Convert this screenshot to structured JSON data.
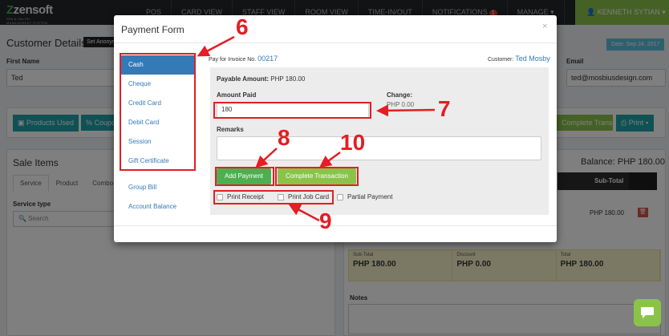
{
  "app": {
    "logo_text": "zensoft",
    "logo_subtext": "SPA & SALON MANAGEMENT SYSTEM",
    "nav": [
      {
        "label": "POS"
      },
      {
        "label": "CARD VIEW"
      },
      {
        "label": "STAFF VIEW"
      },
      {
        "label": "ROOM VIEW"
      },
      {
        "label": "TIME-IN/OUT"
      },
      {
        "label": "NOTIFICATIONS",
        "badge": "1"
      },
      {
        "label": "MANAGE ▾"
      }
    ],
    "user": "KENNETH SYTIAN ▾"
  },
  "background": {
    "customer_title": "Customer Details",
    "anon_button": "Set Anonymous",
    "date": "Date: Sep 24, 2017",
    "first_name_label": "First Name",
    "first_name_value": "Ted",
    "email_label": "Email",
    "email_value": "ted@mosbiusdesign.com",
    "products_button": "Products Used",
    "coupon_button": "Coupons",
    "complete_transaction_button": "Complete Transaction",
    "print_button": "Print ▾",
    "sale_items_title": "Sale Items",
    "tabs": [
      "Service",
      "Product",
      "Combo"
    ],
    "service_type_label": "Service type",
    "search_placeholder": "Search",
    "balance": "Balance: PHP 180.00",
    "table_header_subtotal": "Sub-Total",
    "table_row_subtotal": "PHP 180.00",
    "totals": [
      {
        "label": "Sub-Total",
        "value": "PHP 180.00"
      },
      {
        "label": "Discount",
        "value": "PHP 0.00"
      },
      {
        "label": "Total",
        "value": "PHP 180.00"
      }
    ],
    "notes_label": "Notes"
  },
  "modal": {
    "title": "Payment Form",
    "close": "×",
    "payment_methods": [
      "Cash",
      "Cheque",
      "Credit Card",
      "Debit Card",
      "Session",
      "Gift Certificate"
    ],
    "other_methods": [
      "Group Bill",
      "Account Balance"
    ],
    "invoice_prefix": "Pay for Invoice No.",
    "invoice_number": "00217",
    "customer_prefix": "Customer:",
    "customer_name": "Ted Mosby",
    "payable_label": "Payable Amount:",
    "payable_value": "PHP 180.00",
    "amount_paid_label": "Amount Paid",
    "amount_paid_value": "180",
    "change_label": "Change:",
    "change_value": "PHP 0.00",
    "remarks_label": "Remarks",
    "add_payment_button": "Add Payment",
    "complete_transaction_button": "Complete Transaction",
    "checkboxes": [
      "Print Receipt",
      "Print Job Card",
      "Partial Payment"
    ]
  },
  "annotations": {
    "numbers": [
      "6",
      "7",
      "8",
      "9",
      "10"
    ],
    "color": "#e31e24"
  },
  "colors": {
    "primary": "#337ab7",
    "success": "#4caf50",
    "success_light": "#8bc34a",
    "teal": "#1fa3a8",
    "topbar": "#22262a"
  }
}
